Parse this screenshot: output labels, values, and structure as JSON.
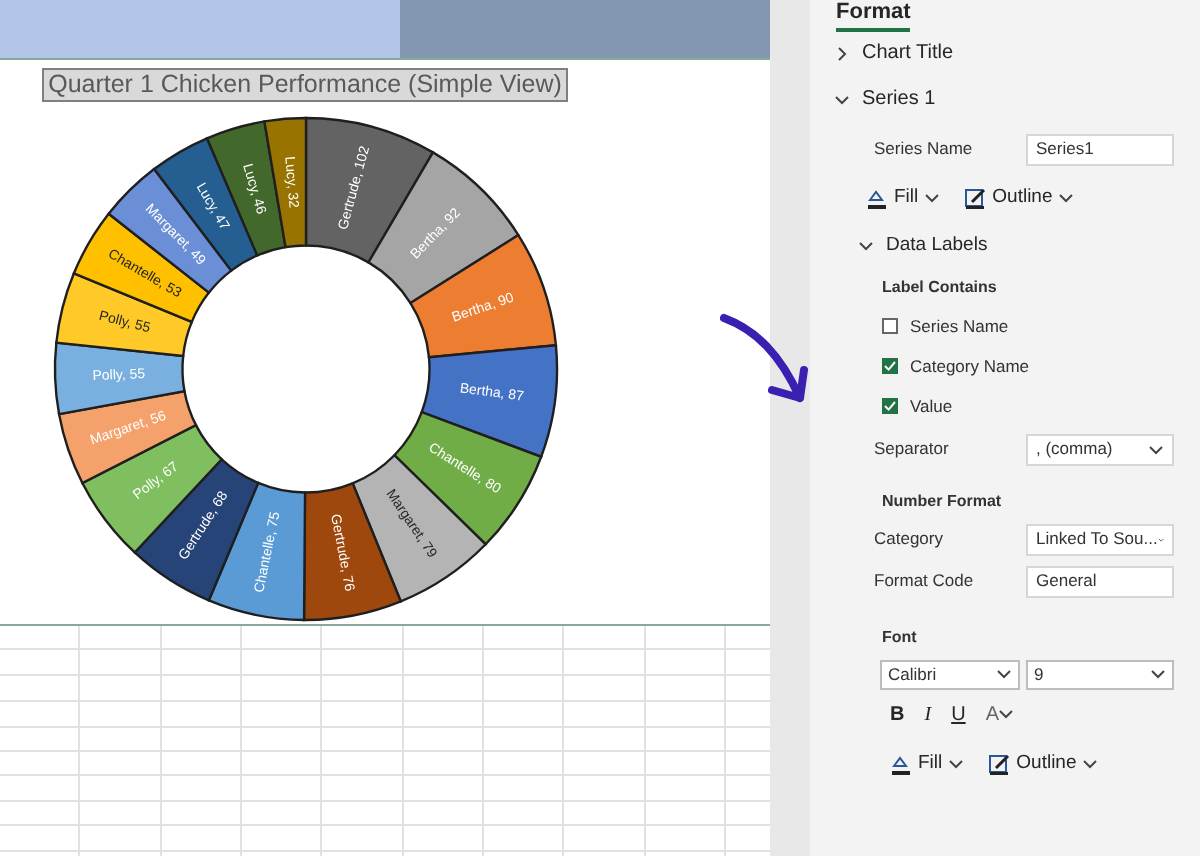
{
  "chart": {
    "chart_data": {
      "type": "donut",
      "title": "Quarter 1 Chicken Performance (Simple View)",
      "value_labels": [
        "Gertrude, 102",
        "Bertha, 92",
        "Bertha, 90",
        "Bertha, 87",
        "Chantelle, 80",
        "Margaret, 79",
        "Gertrude, 76",
        "Chantelle, 75",
        "Gertrude, 68",
        "Polly, 67",
        "Margaret, 56",
        "Polly, 55",
        "Polly, 55",
        "Chantelle, 53",
        "Margaret, 49",
        "Lucy, 47",
        "Lucy, 46",
        "Lucy, 32"
      ],
      "values": [
        102,
        92,
        90,
        87,
        80,
        79,
        76,
        75,
        68,
        67,
        56,
        55,
        55,
        53,
        49,
        47,
        46,
        32
      ],
      "colors": [
        "#636363",
        "#a5a5a5",
        "#ed7d31",
        "#4472c4",
        "#70ad47",
        "#b4b4b4",
        "#9e480e",
        "#5b9bd5",
        "#264478",
        "#7fbf5f",
        "#f4a16b",
        "#7ab0e0",
        "#ffca28",
        "#ffc000",
        "#6a8fd6",
        "#255e91",
        "#43682b",
        "#997300"
      ]
    }
  },
  "panel": {
    "tab": "Format",
    "sections": [
      {
        "label": "Chart Title",
        "expanded": false
      },
      {
        "label": "Series 1",
        "expanded": true
      }
    ],
    "series_name": {
      "label": "Series Name",
      "value": "Series1"
    },
    "series_buttons": [
      "Fill",
      "Outline"
    ],
    "data_labels": {
      "label": "Data Labels",
      "expanded": true
    },
    "label_contains": "Label Contains",
    "checkboxes": [
      {
        "label": "Series Name",
        "checked": false
      },
      {
        "label": "Category Name",
        "checked": true
      },
      {
        "label": "Value",
        "checked": true
      }
    ],
    "separator": {
      "label": "Separator",
      "value": ", (comma)"
    },
    "number_format": "Number Format",
    "category": {
      "label": "Category",
      "value": "Linked To Sou..."
    },
    "format_code": {
      "label": "Format Code",
      "value": "General"
    },
    "font": {
      "label": "Font",
      "family": "Calibri",
      "size": "9"
    },
    "text_styles": [
      "B",
      "I",
      "U",
      "A"
    ],
    "font_buttons": [
      "Fill",
      "Outline"
    ]
  }
}
